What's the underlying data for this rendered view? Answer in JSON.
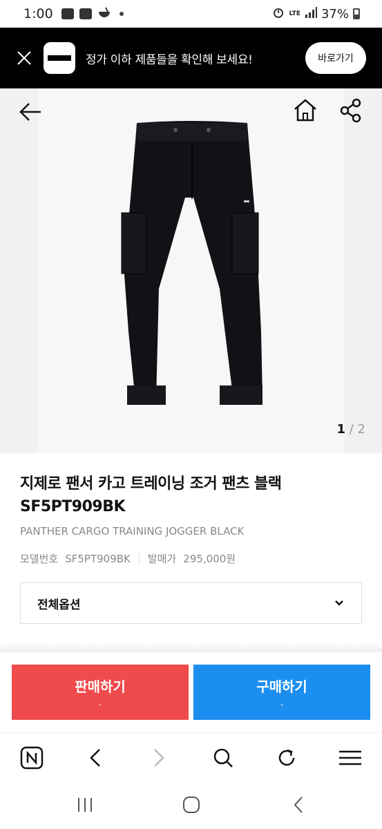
{
  "status_bar": {
    "time": "1:00",
    "network": "LTE",
    "battery": "37%",
    "icons": [
      "youtube-icon",
      "app-icon",
      "bowl-icon",
      "alarm-icon",
      "signal-icon",
      "battery-icon"
    ]
  },
  "promo": {
    "text": "정가 이하 제품들을 확인해 보세요!",
    "button_label": "바로가기"
  },
  "gallery": {
    "current": "1",
    "separator": " / ",
    "total": "2"
  },
  "product": {
    "title_line1": "지제로 팬서 카고 트레이닝 조거 팬츠 블랙",
    "title_line2": "SF5PT909BK",
    "subtitle": "PANTHER CARGO TRAINING JOGGER BLACK",
    "model_label": "모델번호",
    "model_value": "SF5PT909BK",
    "price_label": "발매가",
    "price_value": "295,000원"
  },
  "options": {
    "label": "전체옵션"
  },
  "actions": {
    "sell_label": "판매하기",
    "sell_sub": "-",
    "buy_label": "구매하기",
    "buy_sub": "-"
  },
  "colors": {
    "sell": "#ef4a4c",
    "buy": "#1c8ef0",
    "banner": "#000000"
  }
}
